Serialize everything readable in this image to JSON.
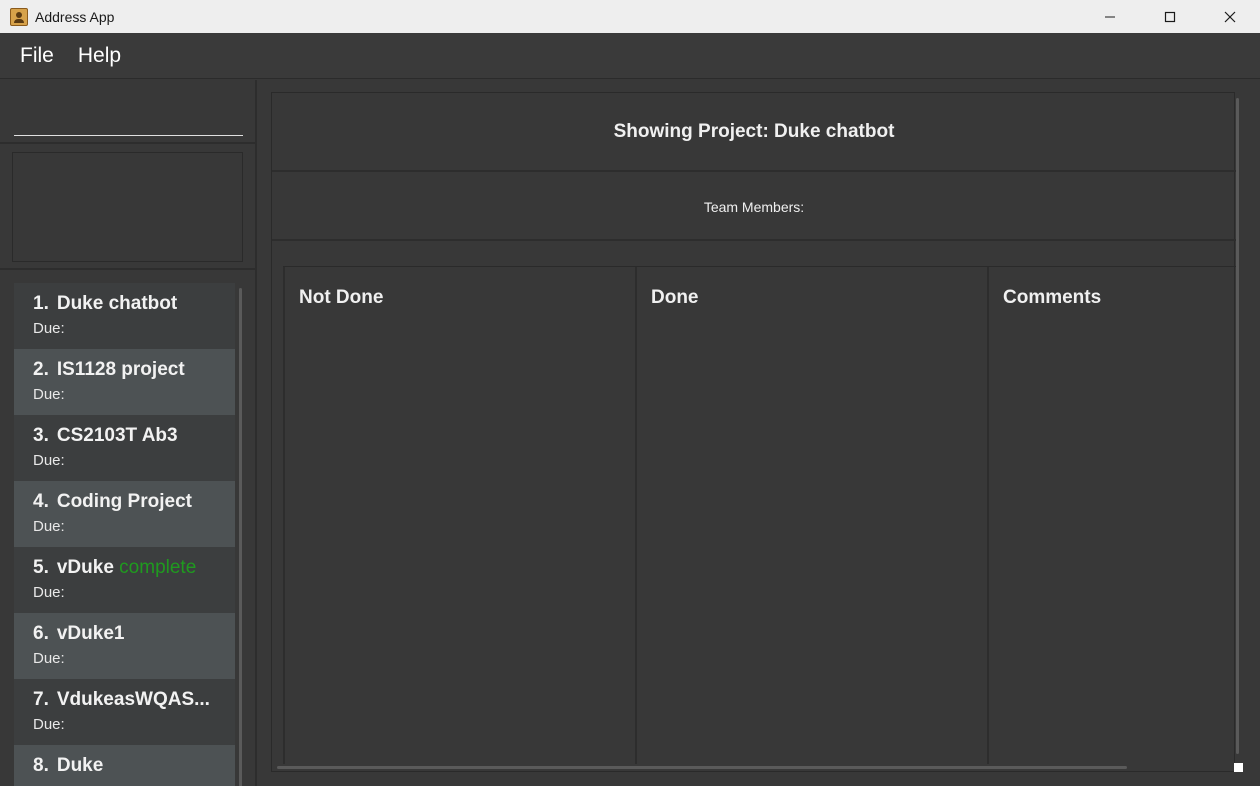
{
  "window": {
    "title": "Address App"
  },
  "menu": {
    "items": [
      "File",
      "Help"
    ]
  },
  "command": {
    "value": "",
    "placeholder": ""
  },
  "projects": [
    {
      "index": "1.",
      "name": "Duke chatbot",
      "status": "",
      "due": "Due:"
    },
    {
      "index": "2.",
      "name": "IS1128 project",
      "status": "",
      "due": "Due:"
    },
    {
      "index": "3.",
      "name": "CS2103T Ab3",
      "status": "",
      "due": "Due:"
    },
    {
      "index": "4.",
      "name": "Coding Project",
      "status": "",
      "due": "Due:"
    },
    {
      "index": "5.",
      "name": "vDuke",
      "status": "complete",
      "due": "Due:"
    },
    {
      "index": "6.",
      "name": "vDuke1",
      "status": "",
      "due": "Due:"
    },
    {
      "index": "7.",
      "name": "VdukeasWQAS...",
      "status": "",
      "due": "Due:"
    },
    {
      "index": "8.",
      "name": "Duke",
      "status": "",
      "due": ""
    }
  ],
  "detail": {
    "title": "Showing Project: Duke chatbot",
    "team_members_label": "Team Members:",
    "columns": [
      "Not Done",
      "Done",
      "Comments"
    ]
  },
  "colors": {
    "complete_status": "#1f9a1f",
    "background": "#383838",
    "list_alt_row": "#4d5254"
  }
}
